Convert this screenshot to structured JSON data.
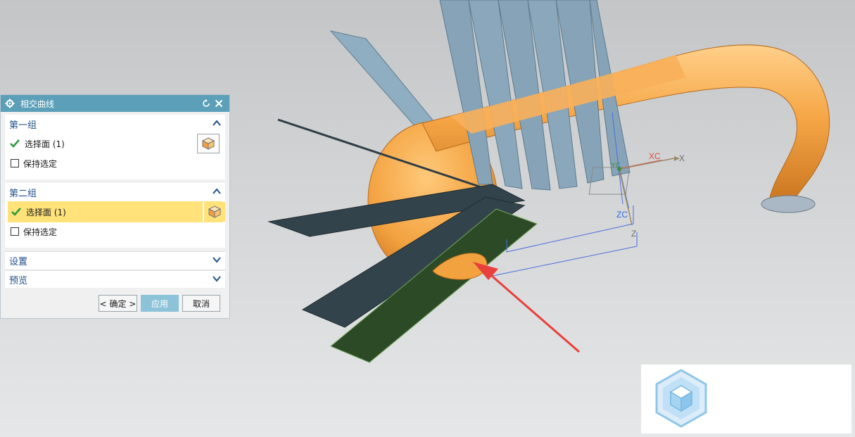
{
  "dialog": {
    "title": "相交曲线",
    "group1": {
      "title": "第一组",
      "select_label": "选择面 (1)",
      "keep_label": "保持选定"
    },
    "group2": {
      "title": "第二组",
      "select_label": "选择面 (1)",
      "keep_label": "保持选定"
    },
    "settings_label": "设置",
    "preview_label": "预览",
    "ok_label": "< 确定 >",
    "apply_label": "应用",
    "cancel_label": "取消"
  },
  "viewport": {
    "axis_labels": {
      "xc": "XC",
      "x": "X",
      "zc": "ZC",
      "z": "Z",
      "yc": "YC"
    }
  },
  "colors": {
    "title_bar": "#5b9fb8",
    "selected_row": "#ffe27a",
    "pipe": "#f2a74a",
    "plane_blue": "#8aa5b9",
    "plane_dark": "#2f3d45",
    "plane_green": "#2d4a27",
    "arrow": "#e8403c"
  }
}
